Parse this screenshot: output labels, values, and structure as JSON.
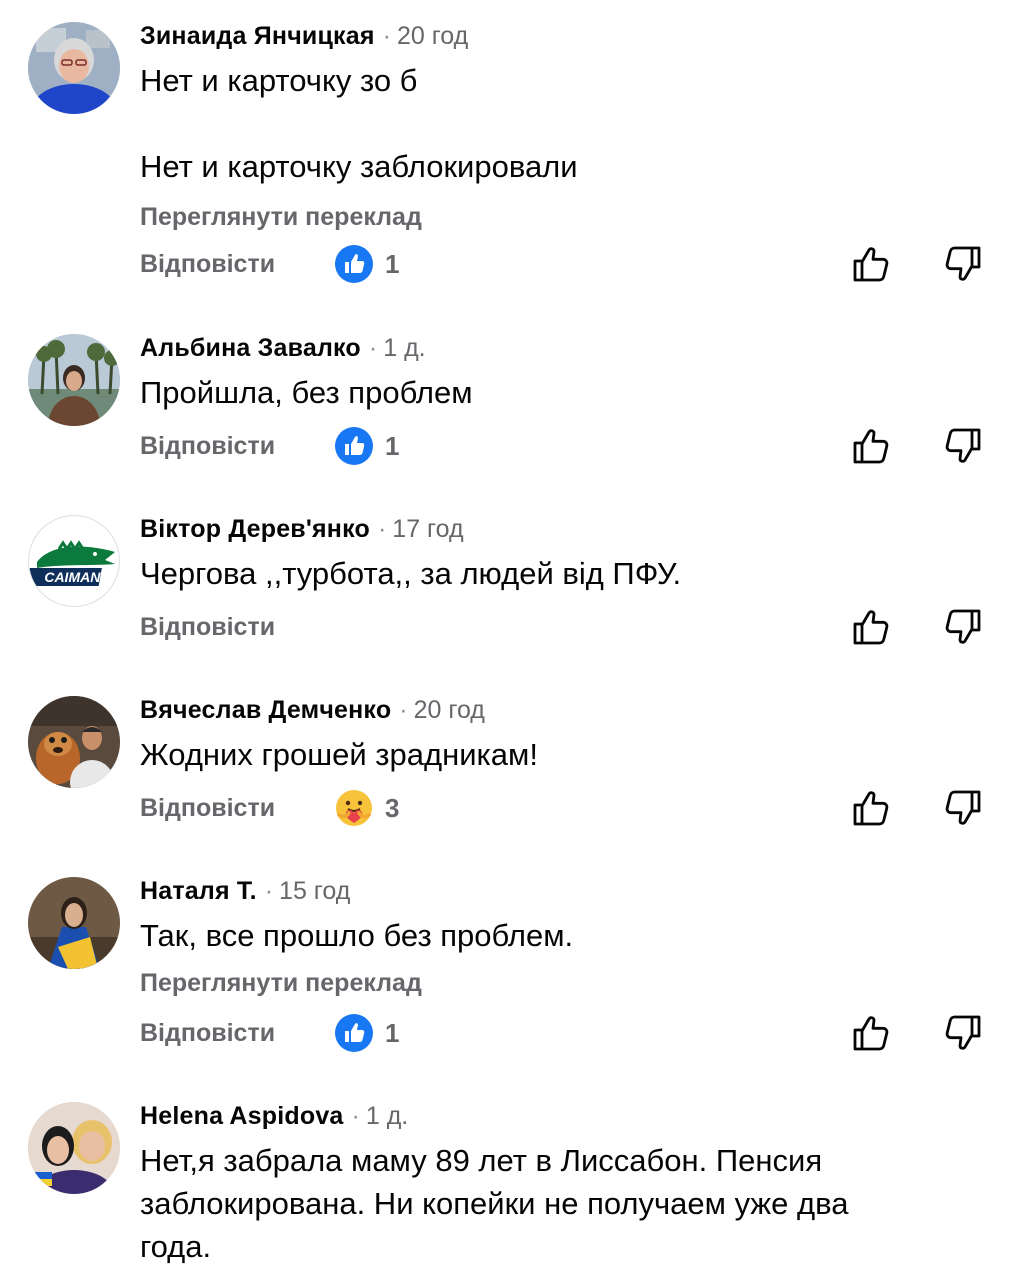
{
  "comments": [
    {
      "author": "Зинаида Янчицкая",
      "separator": "·",
      "time": "20 год",
      "text_lines": [
        "Нет и карточку зо б",
        "",
        "Нет и карточку заблокировали"
      ],
      "translate_label": "Переглянути переклад",
      "reply_label": "Відповісти",
      "reaction": {
        "icon": "like-reaction-icon",
        "count": "1"
      },
      "avatar_colors": {
        "bg": "#9fb0c4",
        "clothes": "#1f45c8",
        "hair": "#d8d8d8",
        "skin": "#e8b9a0"
      }
    },
    {
      "author": "Альбина Завалко",
      "separator": "·",
      "time": "1 д.",
      "text_lines": [
        "Пройшла, без проблем"
      ],
      "reply_label": "Відповісти",
      "reaction": {
        "icon": "like-reaction-icon",
        "count": "1"
      },
      "avatar_colors": {
        "bg": "#8fa7b9",
        "clothes": "#6b4632",
        "hair": "#3a2a22",
        "skin": "#d9a98c"
      }
    },
    {
      "author": "Віктор Дерев'янко",
      "separator": "·",
      "time": "17 год",
      "text_lines": [
        "Чергова ,,турбота,, за людей від ПФУ."
      ],
      "reply_label": "Відповісти",
      "avatar_logo_text": "CAIMANS",
      "avatar_colors": {
        "bg": "#ffffff",
        "logo": "#0b7a3c",
        "logo_dark": "#0d2f5a"
      }
    },
    {
      "author": "Вячеслав Демченко",
      "separator": "·",
      "time": "20 год",
      "text_lines": [
        "Жодних грошей зрадникам!"
      ],
      "reply_label": "Відповісти",
      "reaction": {
        "icon": "care-reaction-icon",
        "count": "3"
      },
      "avatar_colors": {
        "bg": "#5a4a3e",
        "clothes": "#e8e8e8",
        "hair": "#2b2b2b",
        "skin": "#c98f6a"
      }
    },
    {
      "author": "Наталя Т.",
      "separator": "·",
      "time": "15 год",
      "text_lines": [
        "Так, все прошло без проблем."
      ],
      "translate_label": "Переглянути переклад",
      "reply_label": "Відповісти",
      "reaction": {
        "icon": "like-reaction-icon",
        "count": "1"
      },
      "avatar_colors": {
        "bg": "#6e5a44",
        "clothes": "#1a4fb0",
        "accent": "#f2c230",
        "hair": "#2c2018",
        "skin": "#d8b090"
      }
    },
    {
      "author": "Helena Aspidova",
      "separator": "·",
      "time": "1 д.",
      "text_lines": [
        "Нет,я забрала маму 89 лет в Лиссабон. Пенсия",
        "заблокирована. Ни копейки не получаем уже два",
        "года."
      ],
      "avatar_colors": {
        "bg": "#e6d9cf",
        "clothes": "#3a2c6e",
        "hair": "#1c1c1c",
        "hair2": "#e8c26a",
        "skin": "#e9bfa3"
      }
    }
  ],
  "icons": {
    "like_button": "thumbs-up-outline-icon",
    "dislike_button": "thumbs-down-outline-icon"
  },
  "colors": {
    "like_blue": "#1877f2",
    "secondary_text": "#65676b"
  }
}
